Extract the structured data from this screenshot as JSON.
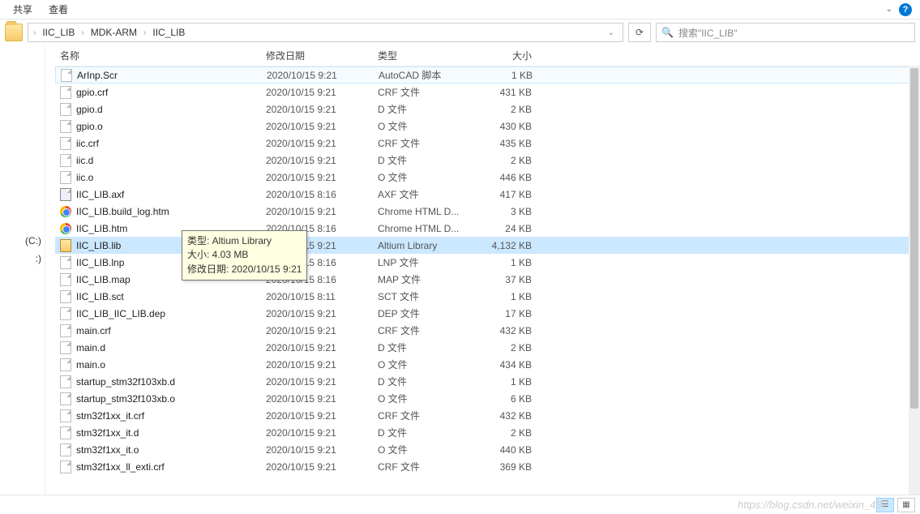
{
  "menu": {
    "share": "共享",
    "view": "查看"
  },
  "help_icon": "?",
  "breadcrumb": {
    "parts": [
      "IIC_LIB",
      "MDK-ARM",
      "IIC_LIB"
    ]
  },
  "search": {
    "placeholder": "搜索\"IIC_LIB\""
  },
  "nav": {
    "drive1": "(C:)",
    "drive2": ":)"
  },
  "headers": {
    "name": "名称",
    "date": "修改日期",
    "type": "类型",
    "size": "大小"
  },
  "tooltip": {
    "line1": "类型: Altium Library",
    "line2": "大小: 4.03 MB",
    "line3": "修改日期: 2020/10/15 9:21"
  },
  "watermark": "https://blog.csdn.net/weixin_437",
  "files": [
    {
      "name": "ArInp.Scr",
      "date": "2020/10/15 9:21",
      "type": "AutoCAD 脚本",
      "size": "1 KB",
      "icon": "file",
      "state": "first-sel"
    },
    {
      "name": "gpio.crf",
      "date": "2020/10/15 9:21",
      "type": "CRF 文件",
      "size": "431 KB",
      "icon": "file"
    },
    {
      "name": "gpio.d",
      "date": "2020/10/15 9:21",
      "type": "D 文件",
      "size": "2 KB",
      "icon": "file"
    },
    {
      "name": "gpio.o",
      "date": "2020/10/15 9:21",
      "type": "O 文件",
      "size": "430 KB",
      "icon": "file"
    },
    {
      "name": "iic.crf",
      "date": "2020/10/15 9:21",
      "type": "CRF 文件",
      "size": "435 KB",
      "icon": "file"
    },
    {
      "name": "iic.d",
      "date": "2020/10/15 9:21",
      "type": "D 文件",
      "size": "2 KB",
      "icon": "file"
    },
    {
      "name": "iic.o",
      "date": "2020/10/15 9:21",
      "type": "O 文件",
      "size": "446 KB",
      "icon": "file"
    },
    {
      "name": "IIC_LIB.axf",
      "date": "2020/10/15 8:16",
      "type": "AXF 文件",
      "size": "417 KB",
      "icon": "axf"
    },
    {
      "name": "IIC_LIB.build_log.htm",
      "date": "2020/10/15 9:21",
      "type": "Chrome HTML D...",
      "size": "3 KB",
      "icon": "chrome"
    },
    {
      "name": "IIC_LIB.htm",
      "date": "2020/10/15 8:16",
      "type": "Chrome HTML D...",
      "size": "24 KB",
      "icon": "chrome"
    },
    {
      "name": "IIC_LIB.lib",
      "date": "2020/10/15 9:21",
      "type": "Altium Library",
      "size": "4,132 KB",
      "icon": "lib",
      "state": "selected"
    },
    {
      "name": "IIC_LIB.lnp",
      "date": "2020/10/15 8:16",
      "type": "LNP 文件",
      "size": "1 KB",
      "icon": "file"
    },
    {
      "name": "IIC_LIB.map",
      "date": "2020/10/15 8:16",
      "type": "MAP 文件",
      "size": "37 KB",
      "icon": "file"
    },
    {
      "name": "IIC_LIB.sct",
      "date": "2020/10/15 8:11",
      "type": "SCT 文件",
      "size": "1 KB",
      "icon": "file"
    },
    {
      "name": "IIC_LIB_IIC_LIB.dep",
      "date": "2020/10/15 9:21",
      "type": "DEP 文件",
      "size": "17 KB",
      "icon": "file"
    },
    {
      "name": "main.crf",
      "date": "2020/10/15 9:21",
      "type": "CRF 文件",
      "size": "432 KB",
      "icon": "file"
    },
    {
      "name": "main.d",
      "date": "2020/10/15 9:21",
      "type": "D 文件",
      "size": "2 KB",
      "icon": "file"
    },
    {
      "name": "main.o",
      "date": "2020/10/15 9:21",
      "type": "O 文件",
      "size": "434 KB",
      "icon": "file"
    },
    {
      "name": "startup_stm32f103xb.d",
      "date": "2020/10/15 9:21",
      "type": "D 文件",
      "size": "1 KB",
      "icon": "file"
    },
    {
      "name": "startup_stm32f103xb.o",
      "date": "2020/10/15 9:21",
      "type": "O 文件",
      "size": "6 KB",
      "icon": "file"
    },
    {
      "name": "stm32f1xx_it.crf",
      "date": "2020/10/15 9:21",
      "type": "CRF 文件",
      "size": "432 KB",
      "icon": "file"
    },
    {
      "name": "stm32f1xx_it.d",
      "date": "2020/10/15 9:21",
      "type": "D 文件",
      "size": "2 KB",
      "icon": "file"
    },
    {
      "name": "stm32f1xx_it.o",
      "date": "2020/10/15 9:21",
      "type": "O 文件",
      "size": "440 KB",
      "icon": "file"
    },
    {
      "name": "stm32f1xx_ll_exti.crf",
      "date": "2020/10/15 9:21",
      "type": "CRF 文件",
      "size": "369 KB",
      "icon": "file"
    }
  ]
}
